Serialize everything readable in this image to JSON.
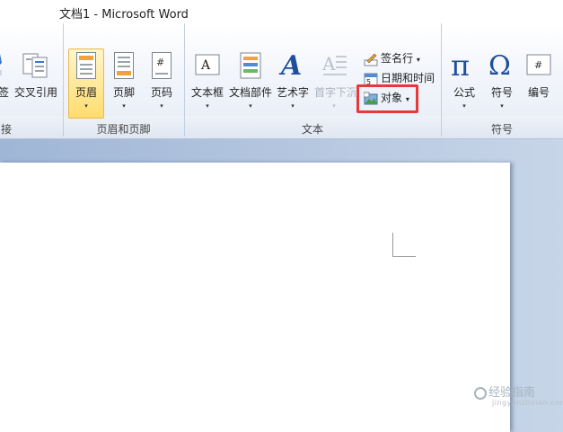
{
  "window": {
    "title": "文档1  -  Microsoft Word"
  },
  "ribbon": {
    "links_group": {
      "partial_label": "接",
      "partial_button": "签",
      "cross_reference": "交叉引用"
    },
    "header_footer_group": {
      "label": "页眉和页脚",
      "header": "页眉",
      "footer": "页脚",
      "page_number": "页码"
    },
    "text_group": {
      "label": "文本",
      "text_box": "文本框",
      "quick_parts": "文档部件",
      "wordart": "艺术字",
      "drop_cap": "首字下沉",
      "signature_line": "签名行",
      "date_time": "日期和时间",
      "object": "对象"
    },
    "symbols_group": {
      "label": "符号",
      "equation": "公式",
      "symbol": "符号",
      "number": "编号"
    },
    "dropdown_arrow": "▾"
  },
  "watermark": {
    "text": "经验指南",
    "url": "jingyanzhinan.com"
  },
  "colors": {
    "accent": "#1f4e9c",
    "highlight": "#ffdc6e",
    "callout": "#e53a3a"
  }
}
